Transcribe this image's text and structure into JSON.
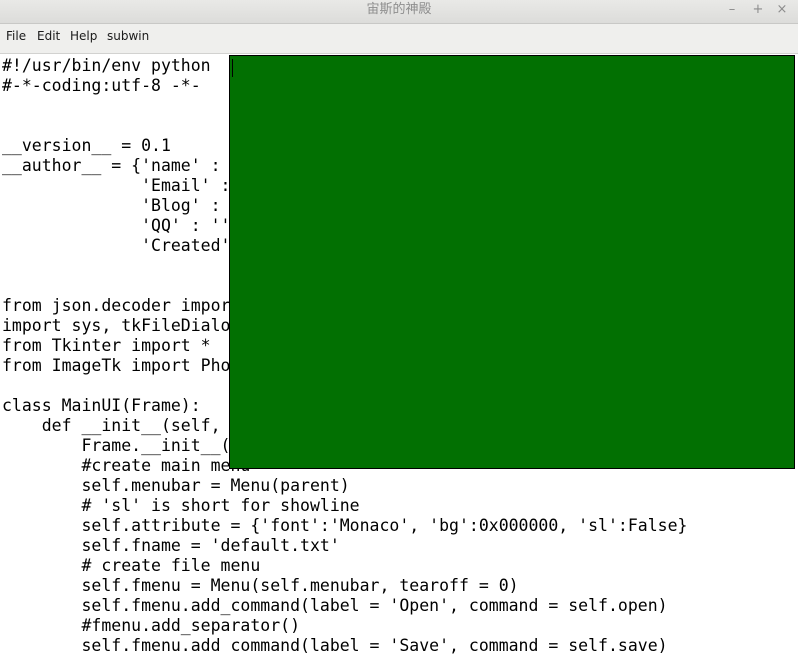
{
  "window": {
    "title": "宙斯的神殿",
    "minimize_icon": "–",
    "maximize_icon": "+",
    "close_icon": "×"
  },
  "menubar": {
    "items": [
      "File",
      "Edit",
      "Help",
      "subwin"
    ]
  },
  "editor": {
    "lines": [
      "#!/usr/bin/env python",
      "#-*-coding:utf-8 -*-",
      "",
      "",
      "__version__ = 0.1",
      "__author__ = {'name' :",
      "              'Email' :",
      "              'Blog' :",
      "              'QQ' : ''",
      "              'Created'",
      "",
      "",
      "from json.decoder impor",
      "import sys, tkFileDialo",
      "from Tkinter import *",
      "from ImageTk import Pho",
      "",
      "class MainUI(Frame):",
      "    def __init__(self,",
      "        Frame.__init__(",
      "        #create main menu",
      "        self.menubar = Menu(parent)",
      "        # 'sl' is short for showline",
      "        self.attribute = {'font':'Monaco', 'bg':0x000000, 'sl':False}",
      "        self.fname = 'default.txt'",
      "        # create file menu",
      "        self.fmenu = Menu(self.menubar, tearoff = 0)",
      "        self.fmenu.add_command(label = 'Open', command = self.open)",
      "        #fmenu.add_separator()",
      "        self.fmenu.add_command(label = 'Save', command = self.save)"
    ]
  },
  "subwin": {
    "background": "#027002"
  }
}
